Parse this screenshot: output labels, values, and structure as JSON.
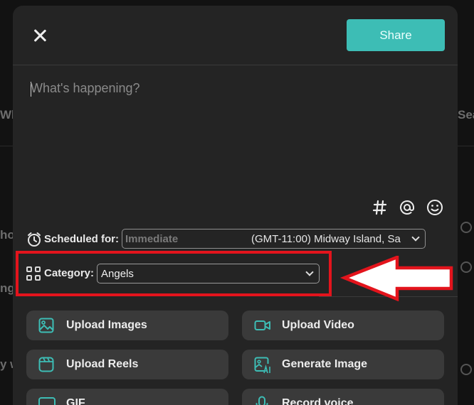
{
  "background": {
    "left_fragments": [
      "Wh",
      "ho",
      "ng",
      "y w"
    ],
    "right_fragments": [
      "Sea"
    ]
  },
  "modal": {
    "share_label": "Share",
    "compose_placeholder": "What's happening?",
    "toolbar_icons": [
      "hashtag-icon",
      "at-icon",
      "emoji-icon"
    ],
    "schedule": {
      "label": "Scheduled for:",
      "value": "Immediate",
      "timezone": "(GMT-11:00) Midway Island, Sa"
    },
    "category": {
      "label": "Category:",
      "value": "Angels"
    },
    "media_buttons": [
      {
        "label": "Upload Images",
        "icon": "image-icon"
      },
      {
        "label": "Upload Video",
        "icon": "video-icon"
      },
      {
        "label": "Upload Reels",
        "icon": "reels-icon"
      },
      {
        "label": "Generate Image",
        "icon": "ai-image-icon"
      },
      {
        "label": "GIF",
        "icon": "gif-icon"
      },
      {
        "label": "Record voice",
        "icon": "microphone-icon"
      }
    ]
  },
  "colors": {
    "accent": "#3dbdb5",
    "highlight": "#e3141c",
    "modal_bg": "#242424"
  }
}
